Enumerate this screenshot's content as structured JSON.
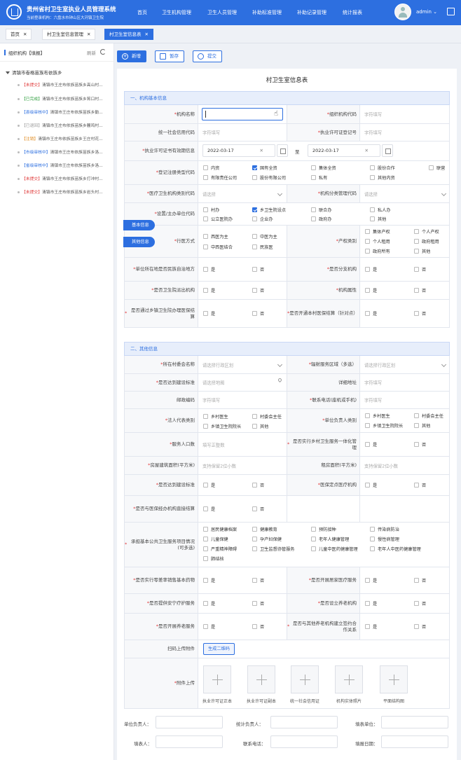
{
  "header": {
    "title": "贵州省村卫生室执业人员管理系统",
    "subtitle": "当前登录机构：六盘水市钟山区大河镇卫生院",
    "nav": [
      "首页",
      "卫生机构管理",
      "卫生人员管理",
      "补助标准管理",
      "补助记录管理",
      "统计报表"
    ],
    "user": "admin",
    "brand_color": "#2d6fe0"
  },
  "tabs": [
    "首页",
    "村卫生室信息管理",
    "村卫生室信息表"
  ],
  "sidebar": {
    "title": "组织机构【填报】",
    "refresh": "刷新",
    "root": "清镇市卷格苗族布依族乡",
    "items": [
      {
        "status": "【未提交】",
        "name": "清镇市王庄布依族苗族乡高山村..."
      },
      {
        "status": "【已完成】",
        "name": "清镇市王庄布依族苗族乡筲口村..."
      },
      {
        "status": "【县级审核中】",
        "name": "清镇市王庄布依族苗族乡勤..."
      },
      {
        "status": "【已退回】",
        "name": "清镇市王庄布依族苗族乡麓鸡村..."
      },
      {
        "status": "【注销】",
        "name": "清镇市王庄布依族苗族乡王庄村花..."
      },
      {
        "status": "【市级审核中】",
        "name": "清镇市王庄布依族苗族乡洛..."
      },
      {
        "status": "【省级审核中】",
        "name": "清镇市王庄布依族苗族乡洛..."
      },
      {
        "status": "【未提交】",
        "name": "清镇市王庄布依族苗族乡打冲村..."
      },
      {
        "status": "【未提交】",
        "name": "清镇市王庄布依族苗族乡岩头村..."
      }
    ]
  },
  "toolbar": {
    "add": "新增",
    "save": "暂存",
    "submit": "提交"
  },
  "form": {
    "title": "村卫生室信息表",
    "sec1": "一、机构基本信息",
    "sec2": "二、其他信息",
    "float_basic": "基本信息",
    "float_other": "其他信息",
    "name_label": "机构名称",
    "org_code": "组织机构代码",
    "credit_code": "统一社会信用代码",
    "license_no": "执业许可证登记号",
    "license_valid": "执业许可证书有效期信息",
    "date_from": "2022-03-17",
    "date_to": "2022-03-17",
    "date_sep": "至",
    "reg_type": "登记注册类型代码",
    "reg_opts": [
      "内资",
      "国有全资",
      "集体全资",
      "股份合作",
      "联营",
      "有限责任公司",
      "股份有限公司",
      "私有",
      "其他内资"
    ],
    "cat_code": "医疗卫生机构类别代码",
    "mgmt_code": "机构分类管理代码",
    "host_code": "设置/主办单位代码",
    "host_opts": [
      "村办",
      "乡卫生院设点",
      "联合办",
      "私人办",
      "公立医院办",
      "企业办",
      "政府办",
      "其他"
    ],
    "mode": "行医方式",
    "mode_opts": [
      "西医为主",
      "中医为主",
      "中西医结合",
      "民族医"
    ],
    "property": "产权类别",
    "prop_opts": [
      "集体产权",
      "个人产权",
      "个人租用",
      "政府租用",
      "政府所有",
      "其他"
    ],
    "ethnic": "单位所在地是否民族自治地方",
    "branch": "是否分支机构",
    "dispatch": "是否卫生院派出机构",
    "attr": "机构属性",
    "insurance": "是否通过乡镇卫生院办理医保结算",
    "insurance2": "是否开通本村医保结算（针对点）",
    "yes": "是",
    "no": "否",
    "committee": "所在村委会名称",
    "area": "辐射服务区域（多选）",
    "standard": "是否达到建设标准",
    "address": "详细地址",
    "postal": "邮政编码",
    "phone": "联系电话(座机或手机)",
    "legal_type": "法人代表类别",
    "legal_opts": [
      "乡村医生",
      "村委会主任",
      "乡镇卫生院院长",
      "其他"
    ],
    "head_type": "单位负责人类别",
    "head_opts": [
      "乡村医生",
      "村委会主任",
      "乡镇卫生院院长",
      "其他"
    ],
    "population": "服务人口数",
    "integrated": "是否实行乡村卫生服务一体化管理",
    "building": "房屋建筑面积(平方米)",
    "rent": "租房面积(平方米)",
    "standard2": "是否达到建设标准",
    "med_point": "医保定点医疗机构",
    "direct": "是否与医保经办机构直接结算",
    "services": "承担基本公共卫生服务项目情况(可多选)",
    "service_opts": [
      "居民健康档案",
      "健康教育",
      "预防接种",
      "传染病防治",
      "儿童保健",
      "孕产妇保健",
      "老年人健康管理",
      "慢性病管理",
      "严重精神障碍",
      "卫生监督协管服务",
      "儿童中医药健康管理",
      "老年人中医药健康管理",
      "肺结核"
    ],
    "zero_markup": "是否实行零差率销售基本药物",
    "family_doc": "是否开展居家医疗服务",
    "hospice": "是否提供安宁疗护服务",
    "elder_inst": "是否设立养老机构",
    "elder_serv": "是否开展养老服务",
    "elder_coop": "是否与其他养老机构建立签约合作关系",
    "scan": "扫码上传附件",
    "qr": "生成二维码",
    "attach": "附件上传",
    "attach_items": [
      "执业许可证正本",
      "执业许可证副本",
      "统一社会信用证",
      "机构实体照片",
      "平面结构图"
    ],
    "footer": {
      "head": "单位负责人：",
      "stat": "统计负责人：",
      "unit": "填表单位：",
      "filler": "填表人：",
      "phone": "联系电话：",
      "date": "填报日期："
    }
  },
  "placeholders": {
    "fill": "字符填写",
    "select": "请选择",
    "select_area": "请选择行政区划",
    "select_map": "请选择地图",
    "int": "填写正整数",
    "decimal": "支持保留2位小数"
  }
}
